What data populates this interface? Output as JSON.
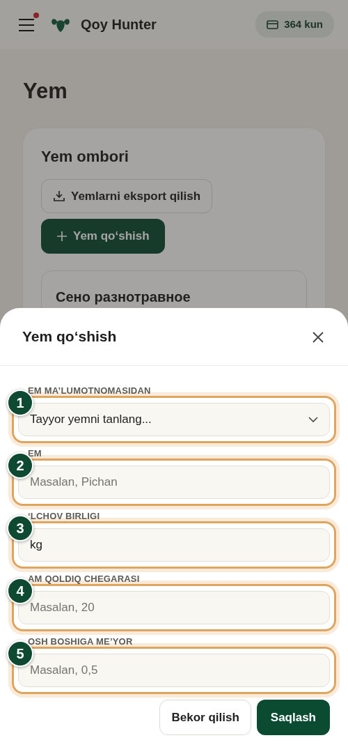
{
  "app_bar": {
    "title": "Qoy Hunter",
    "notification_dot": true,
    "subscription": "364 kun"
  },
  "page": {
    "title": "Yem",
    "card": {
      "title": "Yem ombori",
      "export_button": "Yemlarni eksport qilish",
      "add_button": "Yem qo‘shish",
      "items": [
        {
          "name": "Сено разнотравное"
        }
      ]
    }
  },
  "modal": {
    "title": "Yem qo‘shish",
    "fields": [
      {
        "kind": "select",
        "marker": "1",
        "label": "EM MA’LUMOTNOMASIDAN",
        "value": "Tayyor yemni tanlang...",
        "highlighted": true
      },
      {
        "kind": "input",
        "marker": "2",
        "label": "EM",
        "placeholder": "Masalan, Pichan",
        "highlighted": true
      },
      {
        "kind": "input",
        "marker": "3",
        "label": "‘LCHOV BIRLIGI",
        "value": "kg",
        "highlighted": true
      },
      {
        "kind": "input",
        "marker": "4",
        "label": "AM QOLDIQ CHEGARASI",
        "placeholder": "Masalan, 20",
        "highlighted": true
      },
      {
        "kind": "input",
        "marker": "5",
        "label": "OSH BOSHIGA ME’YOR",
        "placeholder": "Masalan, 0,5",
        "highlighted": true
      }
    ],
    "buttons": [
      {
        "kind": "secondary",
        "label": "Bekor qilish"
      },
      {
        "kind": "primary",
        "label": "Saqlash"
      }
    ]
  }
}
